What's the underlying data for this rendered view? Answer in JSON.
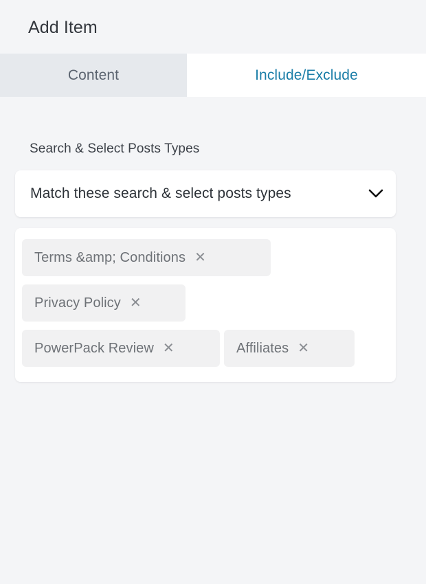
{
  "header": {
    "title": "Add Item"
  },
  "tabs": [
    {
      "label": "Content",
      "active": false,
      "name": "tab-content"
    },
    {
      "label": "Include/Exclude",
      "active": true,
      "name": "tab-include-exclude"
    }
  ],
  "form": {
    "field_label": "Search & Select Posts Types",
    "select": {
      "value": "Match these search & select posts types",
      "chevron_icon": "chevron-down-icon"
    },
    "tags": [
      {
        "label": "Terms &amp; Conditions",
        "remove_icon": "close-icon"
      },
      {
        "label": "Privacy Policy",
        "remove_icon": "close-icon"
      },
      {
        "label": "PowerPack Review",
        "remove_icon": "close-icon"
      },
      {
        "label": "Affiliates",
        "remove_icon": "close-icon"
      }
    ],
    "remove_glyph": "✕"
  },
  "colors": {
    "page_background": "#f4f5f7",
    "tab_active_text": "#1b7ea8",
    "tab_inactive_background": "#e6e9ed",
    "tab_inactive_text": "#5b6470",
    "panel_background": "#ffffff",
    "tag_background": "#f1f1f2",
    "tag_text": "#6e7277",
    "title_text": "#33373d"
  }
}
